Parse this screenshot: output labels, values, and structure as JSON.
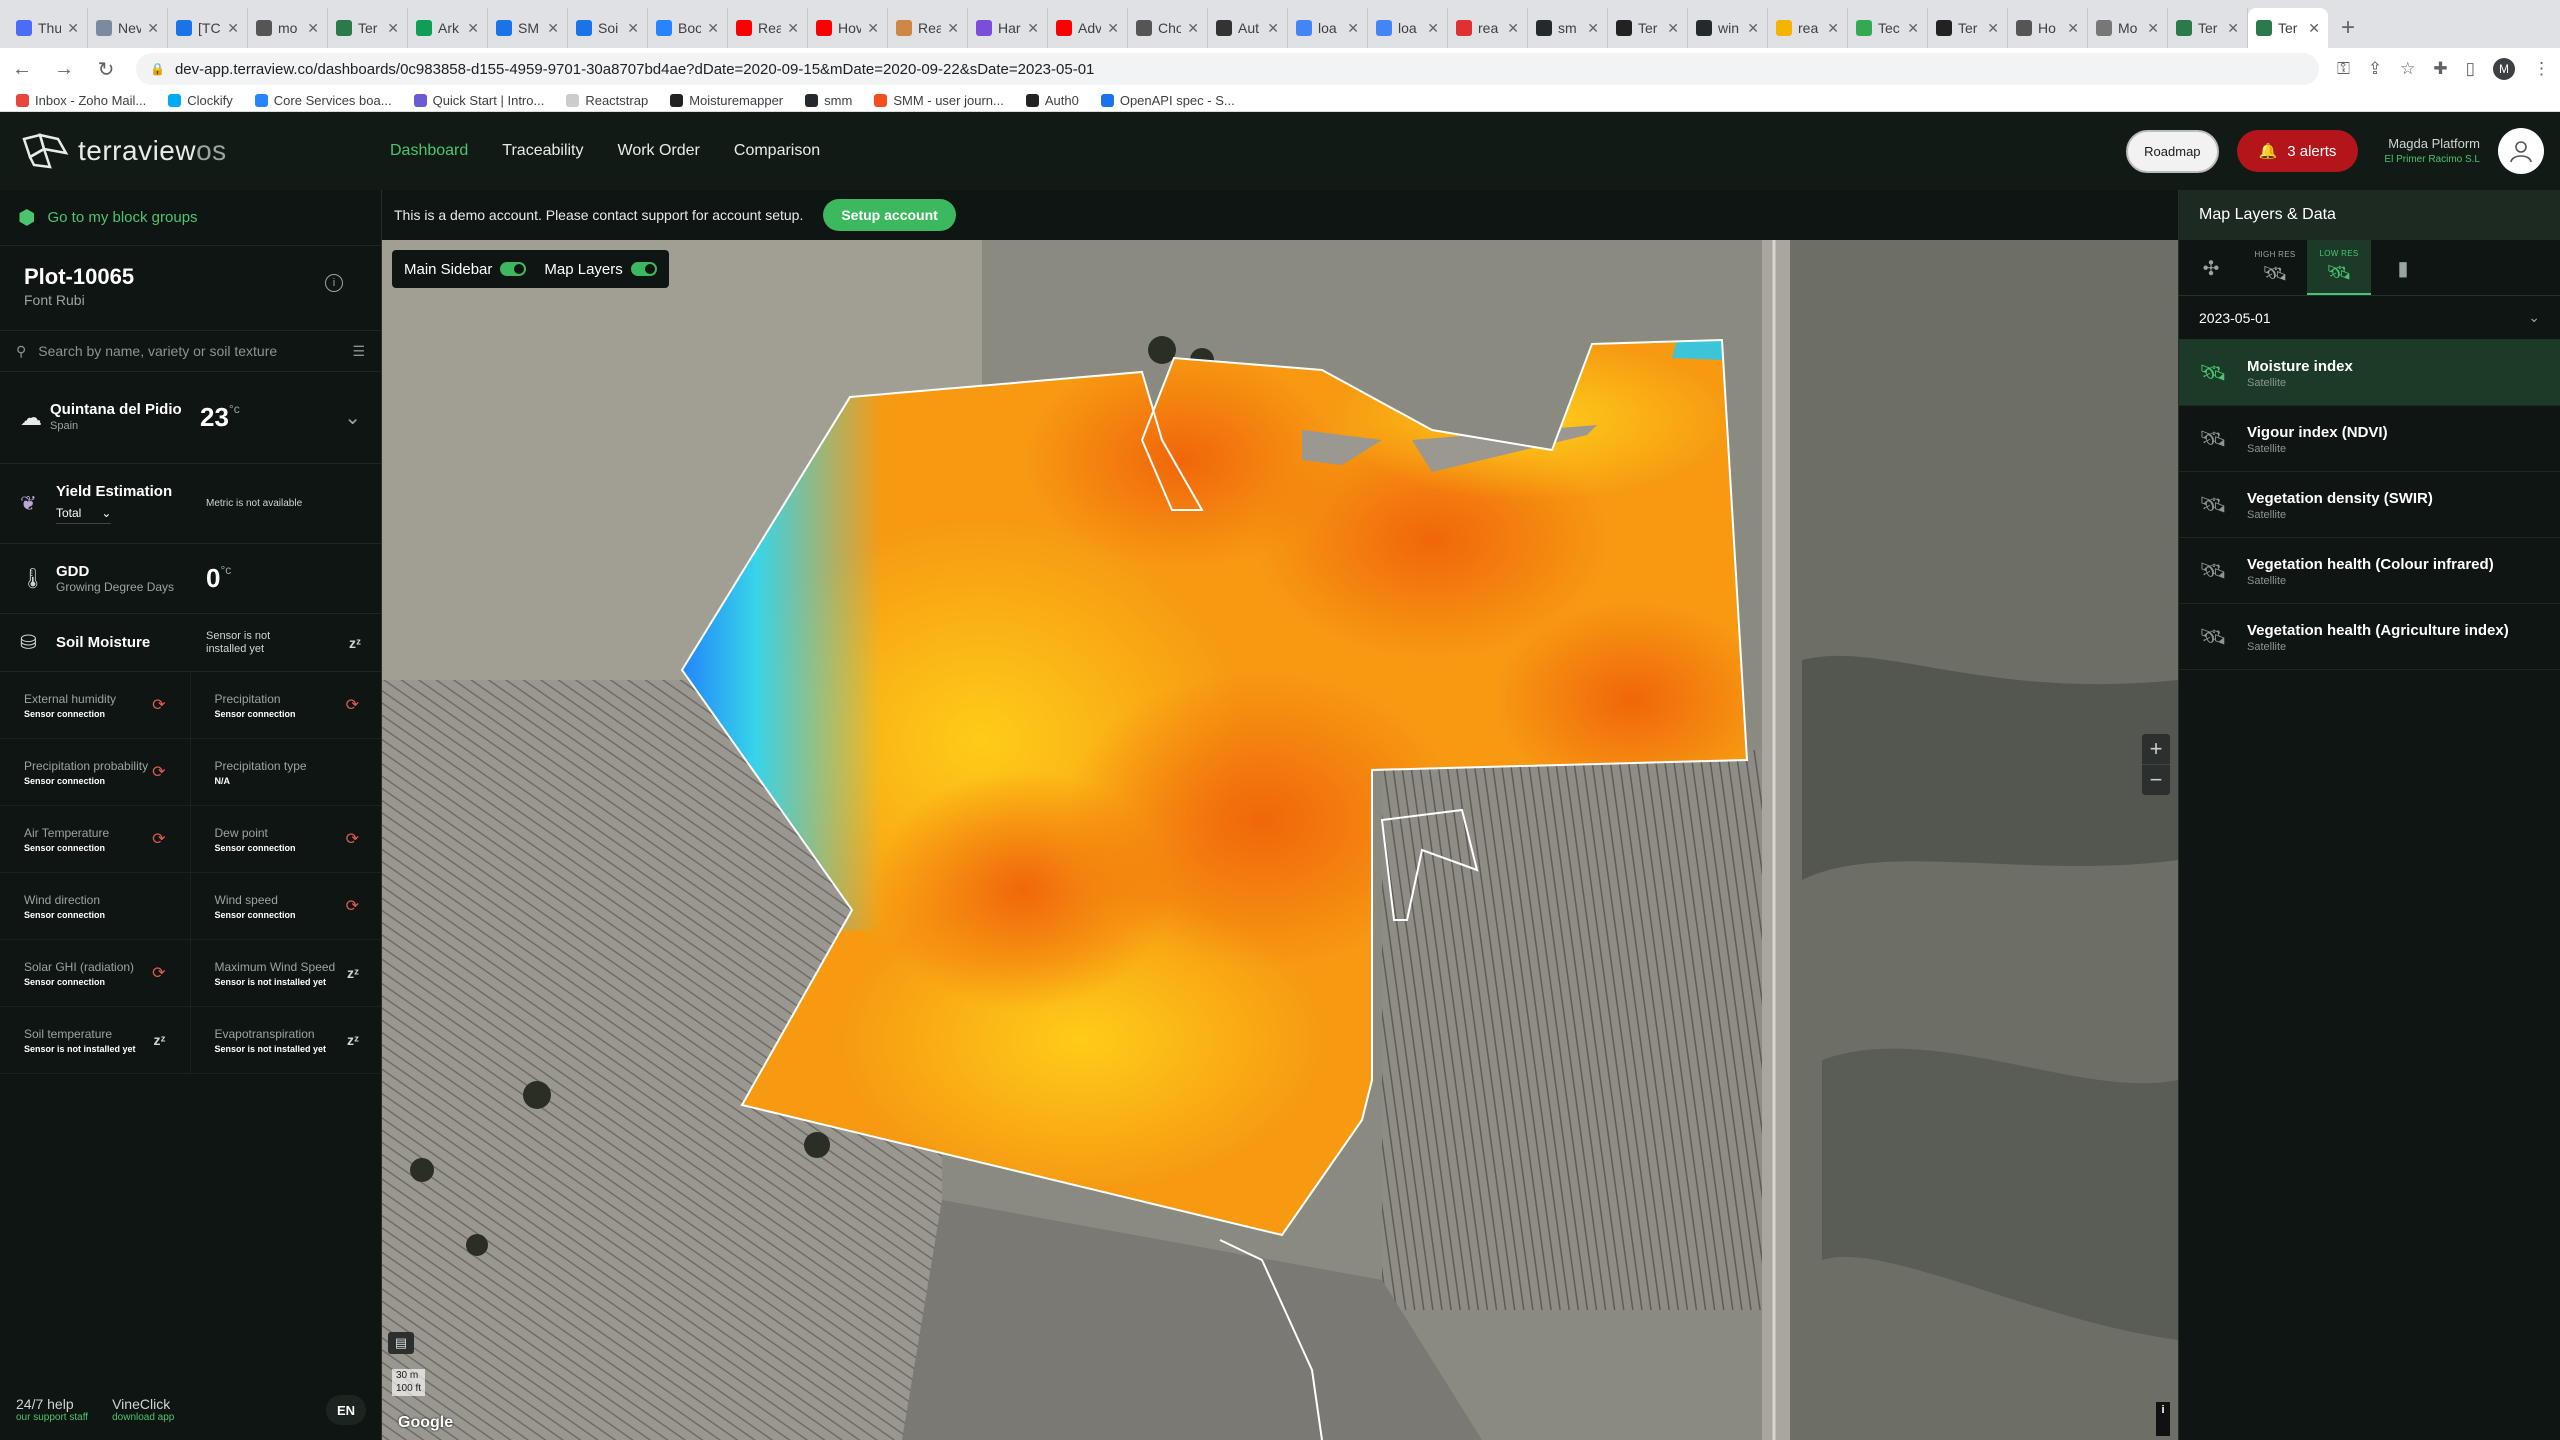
{
  "browser": {
    "tabs": [
      {
        "label": "Thu",
        "color": "#4a6cf7"
      },
      {
        "label": "Nev",
        "color": "#7c8aa0"
      },
      {
        "label": "[TC",
        "color": "#1a73e8"
      },
      {
        "label": "mo",
        "color": "#555555"
      },
      {
        "label": "Ter",
        "color": "#2b7a4b"
      },
      {
        "label": "Ark",
        "color": "#0f9d58"
      },
      {
        "label": "SM",
        "color": "#1a73e8"
      },
      {
        "label": "Soi",
        "color": "#1a73e8"
      },
      {
        "label": "Boo",
        "color": "#2684ff"
      },
      {
        "label": "Rea",
        "color": "#ff0000"
      },
      {
        "label": "Hov",
        "color": "#ff0000"
      },
      {
        "label": "Rea",
        "color": "#cc8844"
      },
      {
        "label": "Har",
        "color": "#7b4ddb"
      },
      {
        "label": "Adv",
        "color": "#ff0000"
      },
      {
        "label": "Cho",
        "color": "#555555"
      },
      {
        "label": "Aut",
        "color": "#333333"
      },
      {
        "label": "loa",
        "color": "#4285f4"
      },
      {
        "label": "loa",
        "color": "#4285f4"
      },
      {
        "label": "rea",
        "color": "#e03030"
      },
      {
        "label": "sm",
        "color": "#24292e"
      },
      {
        "label": "Ter",
        "color": "#222222"
      },
      {
        "label": "win",
        "color": "#24292e"
      },
      {
        "label": "rea",
        "color": "#f4b400"
      },
      {
        "label": "Tec",
        "color": "#34a853"
      },
      {
        "label": "Ter",
        "color": "#222222"
      },
      {
        "label": "Ho",
        "color": "#555555"
      },
      {
        "label": "Mo",
        "color": "#777777"
      },
      {
        "label": "Ter",
        "color": "#2b7a4b"
      },
      {
        "label": "Ter",
        "color": "#2b7a4b"
      }
    ],
    "url": "dev-app.terraview.co/dashboards/0c983858-d155-4959-9701-30a8707bd4ae?dDate=2020-09-15&mDate=2020-09-22&sDate=2023-05-01",
    "profile_initial": "M",
    "bookmarks": [
      {
        "label": "Inbox - Zoho Mail...",
        "color": "#e8453c"
      },
      {
        "label": "Clockify",
        "color": "#03a9f4"
      },
      {
        "label": "Core Services boa...",
        "color": "#2684ff"
      },
      {
        "label": "Quick Start | Intro...",
        "color": "#6b5bd2"
      },
      {
        "label": "Reactstrap",
        "color": "#cccccc"
      },
      {
        "label": "Moisturemapper",
        "color": "#222222"
      },
      {
        "label": "smm",
        "color": "#24292e"
      },
      {
        "label": "SMM - user journ...",
        "color": "#f24e1e"
      },
      {
        "label": "Auth0",
        "color": "#222222"
      },
      {
        "label": "OpenAPI spec - S...",
        "color": "#1a73e8"
      }
    ]
  },
  "header": {
    "logo_text": "terraview",
    "logo_suffix": "os",
    "nav": [
      "Dashboard",
      "Traceability",
      "Work Order",
      "Comparison"
    ],
    "roadmap_label": "Roadmap",
    "alerts_label": "3 alerts",
    "user_name": "Magda Platform",
    "user_org": "El Primer Racimo S.L"
  },
  "sidebar": {
    "back_link": "Go to my block groups",
    "plot_title": "Plot-10065",
    "plot_variety": "Font Rubi",
    "search_placeholder": "Search by name, variety or soil texture",
    "weather": {
      "location": "Quintana del Pidio",
      "country": "Spain",
      "temp": "23",
      "unit": "°c"
    },
    "yield": {
      "title": "Yield Estimation",
      "select": "Total",
      "value": "Metric is not available"
    },
    "gdd": {
      "title": "GDD",
      "subtitle": "Growing Degree Days",
      "value": "0",
      "unit": "°c"
    },
    "soil_moisture": {
      "title": "Soil Moisture",
      "status": "Sensor is not installed yet"
    },
    "sensors": [
      {
        "label": "External humidity",
        "status": "Sensor connection",
        "icon": "sync-error-icon"
      },
      {
        "label": "Precipitation",
        "status": "Sensor connection",
        "icon": "sync-error-icon"
      },
      {
        "label": "Precipitation probability",
        "status": "Sensor connection",
        "icon": "sync-error-icon"
      },
      {
        "label": "Precipitation type",
        "status": "N/A",
        "icon": "none"
      },
      {
        "label": "Air Temperature",
        "status": "Sensor connection",
        "icon": "sync-error-icon"
      },
      {
        "label": "Dew point",
        "status": "Sensor connection",
        "icon": "sync-error-icon"
      },
      {
        "label": "Wind direction",
        "status": "Sensor connection",
        "icon": "none"
      },
      {
        "label": "Wind speed",
        "status": "Sensor connection",
        "icon": "sync-error-icon"
      },
      {
        "label": "Solar GHI (radiation)",
        "status": "Sensor connection",
        "icon": "sync-error-icon"
      },
      {
        "label": "Maximum Wind Speed",
        "status": "Sensor is not installed yet",
        "icon": "sleep-icon"
      },
      {
        "label": "Soil temperature",
        "status": "Sensor is not installed yet",
        "icon": "sleep-icon"
      },
      {
        "label": "Evapotranspiration",
        "status": "Sensor is not installed yet",
        "icon": "sleep-icon"
      }
    ],
    "help_label": "24/7 help",
    "help_sub": "our support staff",
    "vineclick_label": "VineClick",
    "vineclick_sub": "download app",
    "lang": "EN"
  },
  "banner": {
    "text": "This is a demo account. Please contact support for account setup.",
    "button": "Setup account"
  },
  "map": {
    "main_sidebar_label": "Main Sidebar",
    "map_layers_label": "Map Layers",
    "scale_m": "30 m",
    "scale_ft": "100 ft",
    "attribution": "Google",
    "zoom_in": "+",
    "zoom_out": "−",
    "info": "i"
  },
  "layers": {
    "title": "Map Layers & Data",
    "res_tabs": [
      {
        "label": "",
        "icon": "drone-icon"
      },
      {
        "label": "HIGH RES",
        "icon": "satellite-icon"
      },
      {
        "label": "LOW RES",
        "icon": "satellite-icon"
      },
      {
        "label": "",
        "icon": "sensor-icon"
      }
    ],
    "date": "2023-05-01",
    "items": [
      {
        "title": "Moisture index",
        "sub": "Satellite"
      },
      {
        "title": "Vigour index (NDVI)",
        "sub": "Satellite"
      },
      {
        "title": "Vegetation density (SWIR)",
        "sub": "Satellite"
      },
      {
        "title": "Vegetation health (Colour infrared)",
        "sub": "Satellite"
      },
      {
        "title": "Vegetation health (Agriculture index)",
        "sub": "Satellite"
      }
    ]
  }
}
